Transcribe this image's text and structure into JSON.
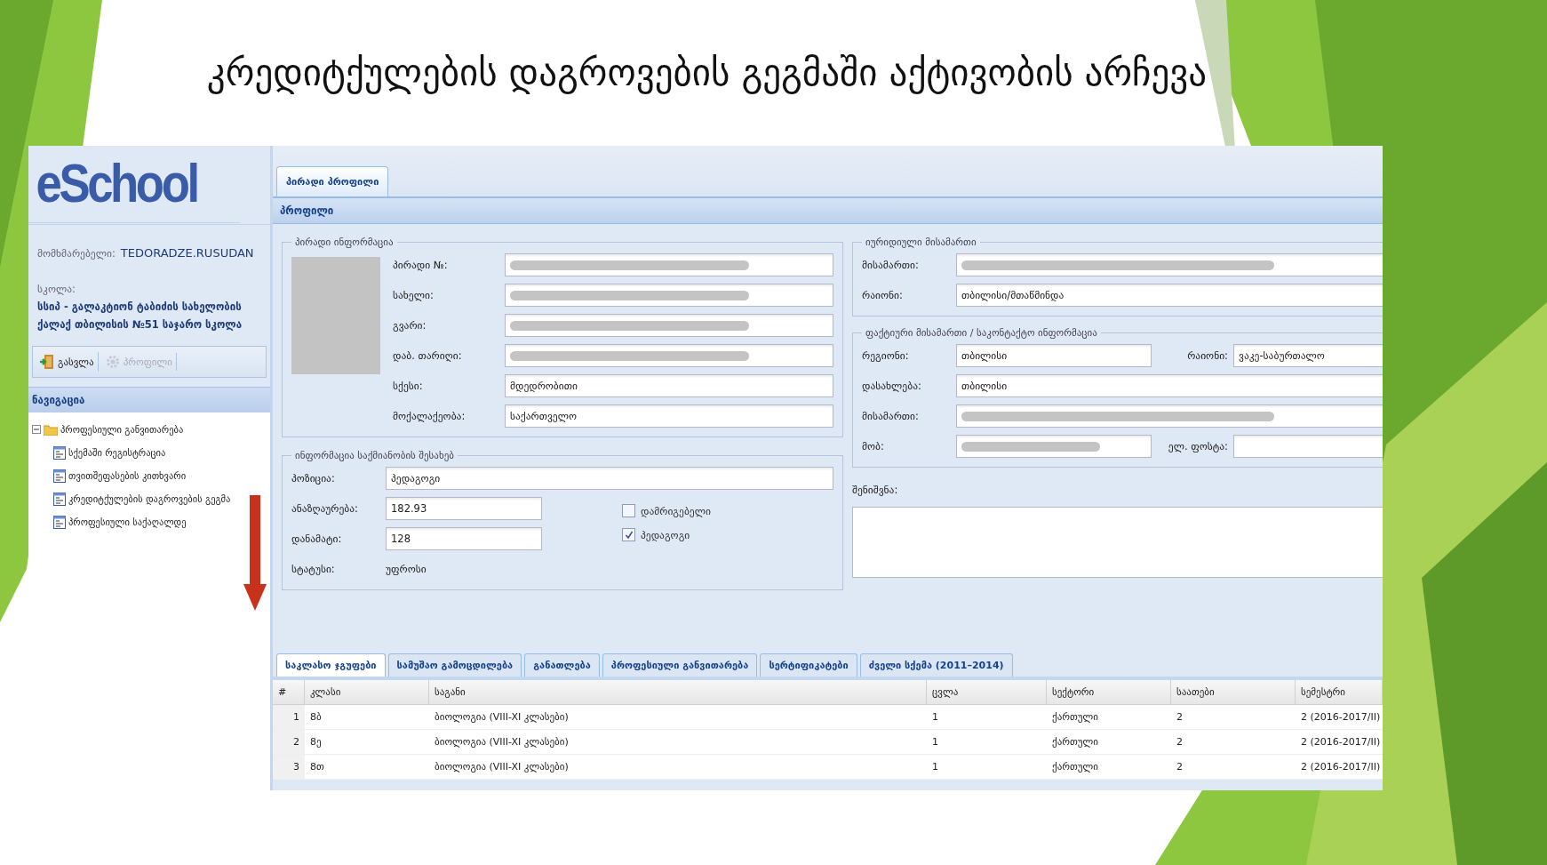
{
  "slide_title": "კრედიტქულების დაგროვების გეგმაში აქტივობის არჩევა",
  "app": {
    "logo": "eSchool",
    "user": {
      "label": "მომხმარებელი:",
      "value": "TEDORADZE.RUSUDAN"
    },
    "school": {
      "label": "სკოლა:",
      "value": "სსიპ - გალაკტიონ ტაბიძის სახელობის ქალაქ თბილისის №51 საჯარო სკოლა"
    },
    "toolbar": [
      {
        "kind": "exit",
        "label": "გასვლა",
        "disabled": false
      },
      {
        "kind": "settings",
        "label": "პროფილი",
        "disabled": true
      }
    ],
    "navigation": {
      "title": "ნავიგაცია",
      "tree": [
        {
          "label": "პროფესიული განვითარება",
          "expanded": true,
          "children": [
            {
              "label": "სქემაში რეგისტრაცია"
            },
            {
              "label": "თვითშეფასების კითხვარი"
            },
            {
              "label": "კრედიტქულების დაგროვების გეგმა"
            },
            {
              "label": "პროფესიული საქაღალდე"
            }
          ]
        }
      ]
    },
    "top_tabs": [
      {
        "label": "პირადი პროფილი",
        "selected": true
      }
    ],
    "panel_title": "პროფილი",
    "personal_info": {
      "legend": "პირადი ინფორმაცია",
      "fields": [
        {
          "label": "პირადი №:",
          "blurred": true
        },
        {
          "label": "სახელი:",
          "blurred": true
        },
        {
          "label": "გვარი:",
          "blurred": true
        },
        {
          "label": "დაბ. თარიღი:",
          "blurred": true
        },
        {
          "label": "სქესი:",
          "value": "მდედრობითი"
        },
        {
          "label": "მოქალაქეობა:",
          "value": "საქართველო"
        }
      ]
    },
    "legal_address": {
      "legend": "იურიდიული მისამართი",
      "rows": [
        [
          {
            "label": "მისამართი:",
            "blurred": true
          }
        ],
        [
          {
            "label": "რაიონი:",
            "value": "თბილისი/მთაწმინდა"
          }
        ]
      ]
    },
    "actual_address": {
      "legend": "ფაქტიური მისამართი / საკონტაქტო ინფორმაცია",
      "rows": [
        [
          {
            "label": "რეგიონი:",
            "value": "თბილისი"
          },
          {
            "label": "რაიონი:",
            "value": "ვაკე-საბურთალო"
          }
        ],
        [
          {
            "label": "დასახლება:",
            "value": "თბილისი"
          }
        ],
        [
          {
            "label": "მისამართი:",
            "blurred": true
          }
        ],
        [
          {
            "label": "მობ:",
            "blurred": true
          },
          {
            "label": "ელ. ფოსტა:"
          }
        ]
      ]
    },
    "notes": {
      "label": "შენიშვნა:"
    },
    "activity": {
      "legend": "ინფორმაცია საქმიანობის შესახებ",
      "position": {
        "label": "პოზიცია:",
        "value": "პედაგოგი"
      },
      "salary": {
        "label": "ანაზღაურება:",
        "value": "182.93"
      },
      "bonus": {
        "label": "დანამატი:",
        "value": "128"
      },
      "status": {
        "label": "სტატუსი:",
        "value": "უფროსი"
      },
      "checkboxes": [
        {
          "label": "დამრიგებელი",
          "checked": false
        },
        {
          "label": "პედაგოგი",
          "checked": true
        }
      ]
    },
    "bottom_tabs": [
      {
        "label": "საკლასო ჯგუფები",
        "selected": true
      },
      {
        "label": "სამუშაო გამოცდილება",
        "selected": false
      },
      {
        "label": "განათლება",
        "selected": false
      },
      {
        "label": "პროფესიული განვითარება",
        "selected": false
      },
      {
        "label": "სერტიფიკატები",
        "selected": false
      },
      {
        "label": "ძველი სქემა (2011–2014)",
        "selected": false
      }
    ],
    "table": {
      "columns": [
        "#",
        "კლასი",
        "საგანი",
        "ცვლა",
        "სექტორი",
        "საათები",
        "სემესტრი"
      ],
      "rows": [
        [
          "1",
          "8ბ",
          "ბიოლოგია (VIII-XI კლასები)",
          "1",
          "ქართული",
          "2",
          "2 (2016-2017/II)"
        ],
        [
          "2",
          "8ე",
          "ბიოლოგია (VIII-XI კლასები)",
          "1",
          "ქართული",
          "2",
          "2 (2016-2017/II)"
        ],
        [
          "3",
          "8თ",
          "ბიოლოგია (VIII-XI კლასები)",
          "1",
          "ქართული",
          "2",
          "2 (2016-2017/II)"
        ]
      ]
    }
  }
}
